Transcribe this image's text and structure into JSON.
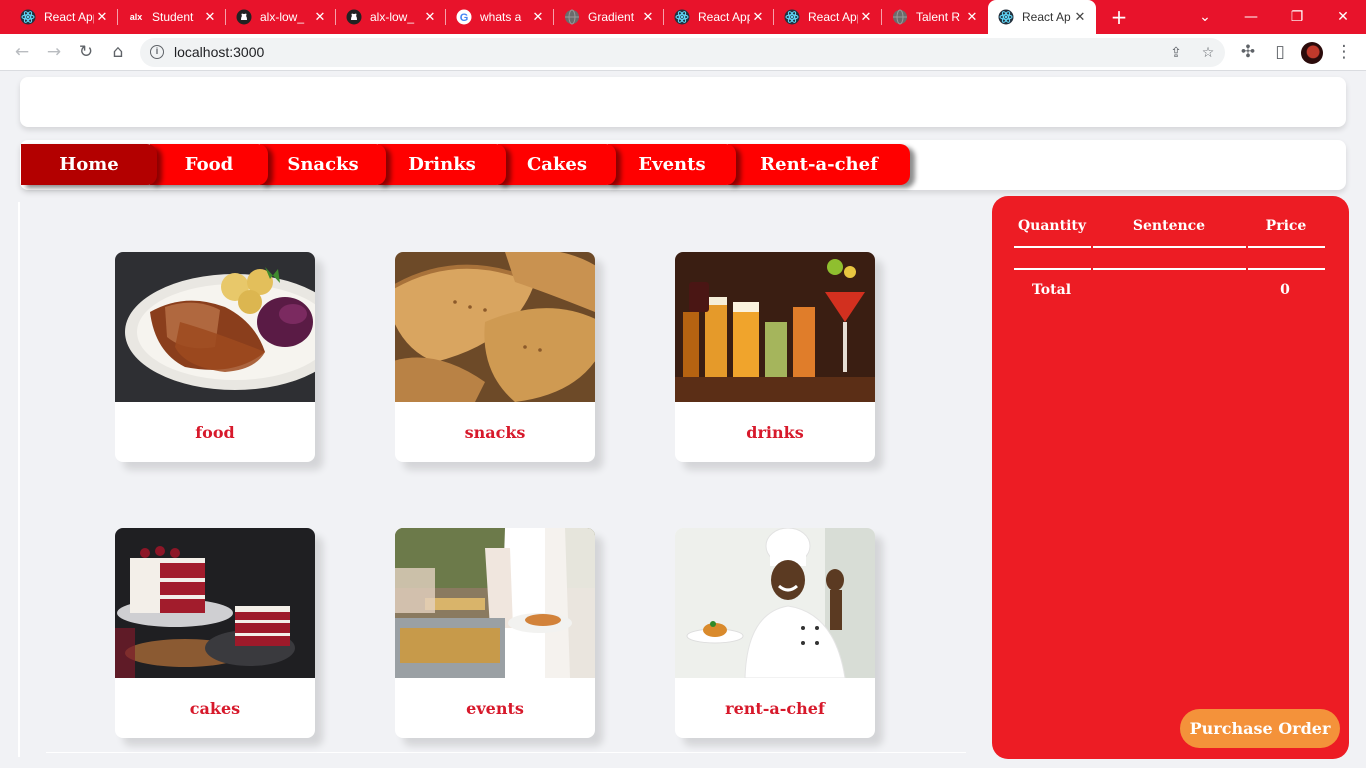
{
  "browser": {
    "tabs": [
      {
        "title": "React App",
        "icon": "react-icon"
      },
      {
        "title": "Student",
        "icon": "alx-icon"
      },
      {
        "title": "alx-low_",
        "icon": "github-icon"
      },
      {
        "title": "alx-low_",
        "icon": "github-icon"
      },
      {
        "title": "whats a",
        "icon": "google-icon"
      },
      {
        "title": "Gradient",
        "icon": "globe-icon"
      },
      {
        "title": "React App",
        "icon": "react-icon"
      },
      {
        "title": "React App",
        "icon": "react-icon"
      },
      {
        "title": "Talent R",
        "icon": "globe-icon"
      },
      {
        "title": "React Ap",
        "icon": "react-icon",
        "active": true
      }
    ],
    "new_tab": "+",
    "url": "localhost:3000",
    "accent_color": "#e8132b"
  },
  "nav": {
    "items": [
      "Home",
      "Food",
      "Snacks",
      "Drinks",
      "Cakes",
      "Events",
      "Rent-a-chef"
    ],
    "active": "Home"
  },
  "categories": [
    {
      "label": "food",
      "image": "roast-meat-plate-photo"
    },
    {
      "label": "snacks",
      "image": "pastries-photo"
    },
    {
      "label": "drinks",
      "image": "cocktails-photo"
    },
    {
      "label": "cakes",
      "image": "red-velvet-cake-photo"
    },
    {
      "label": "events",
      "image": "buffet-catering-photo"
    },
    {
      "label": "rent-a-chef",
      "image": "chef-photo"
    }
  ],
  "order": {
    "headers": [
      "Quantity",
      "Sentence",
      "Price"
    ],
    "total_label": "Total",
    "total_value": "0",
    "purchase_label": "Purchase Order",
    "panel_color": "#ed1c24",
    "button_color": "#f4923a"
  }
}
